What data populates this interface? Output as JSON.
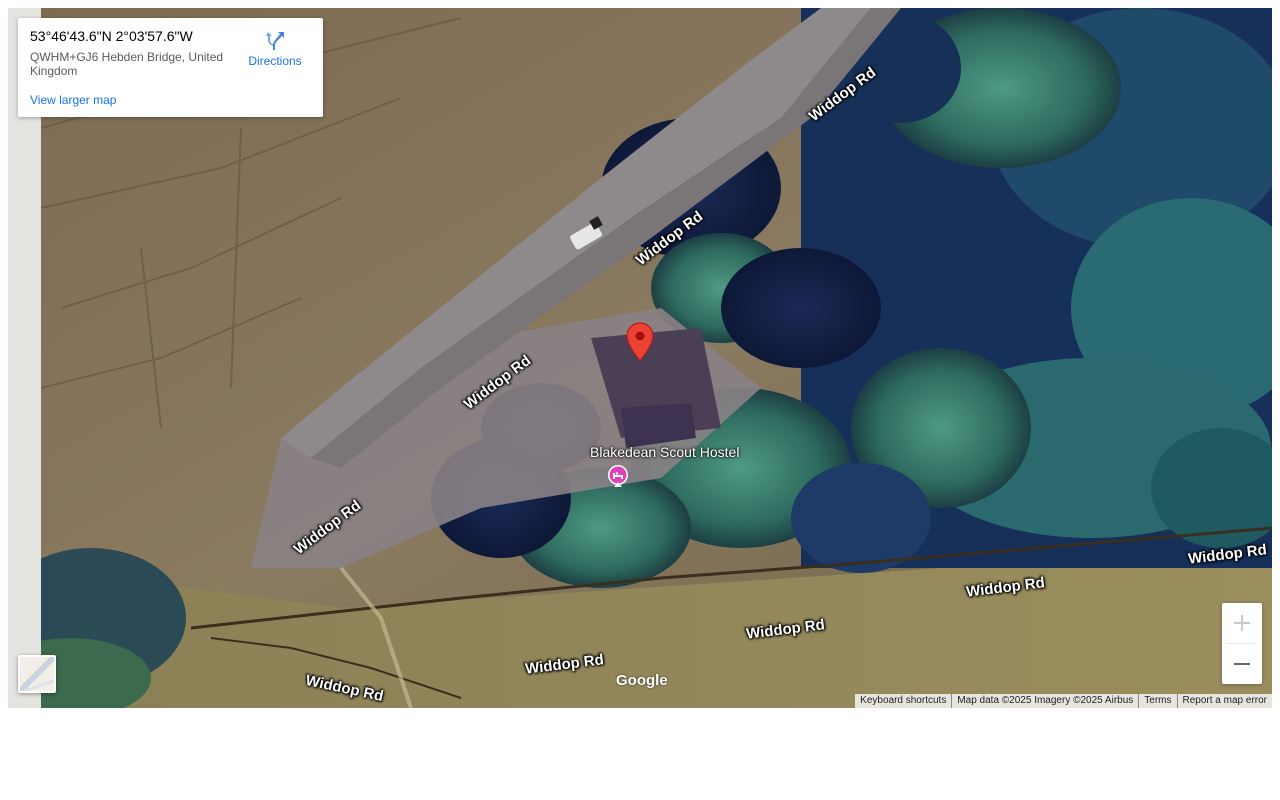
{
  "info_card": {
    "title": "53°46'43.6\"N 2°03'57.6\"W",
    "address": "QWHM+GJ6 Hebden Bridge, United Kingdom",
    "directions_label": "Directions",
    "view_larger_label": "View larger map"
  },
  "map": {
    "road_labels": [
      "Widdop Rd",
      "Widdop Rd",
      "Widdop Rd",
      "Widdop Rd",
      "Widdop Rd",
      "Widdop Rd",
      "Widdop Rd",
      "Widdop Rd",
      "Widdop Rd",
      "Widdop Rd"
    ],
    "poi": {
      "name": "Blakedean Scout Hostel",
      "icon": "hostel-bed-icon",
      "color": "#e040b8"
    },
    "marker": {
      "icon": "red-location-pin-icon",
      "color": "#ea4335"
    },
    "brand": "Google"
  },
  "controls": {
    "zoom_in_icon": "plus-icon",
    "zoom_out_icon": "minus-icon",
    "layer_icon": "map-layer-thumbnail"
  },
  "attribution": {
    "keyboard": "Keyboard shortcuts",
    "map_data": "Map data ©2025 Imagery ©2025 Airbus",
    "terms": "Terms",
    "report": "Report a map error"
  },
  "colors": {
    "link": "#1a73e8",
    "hostel": "#e040b8",
    "pin": "#ea4335"
  }
}
